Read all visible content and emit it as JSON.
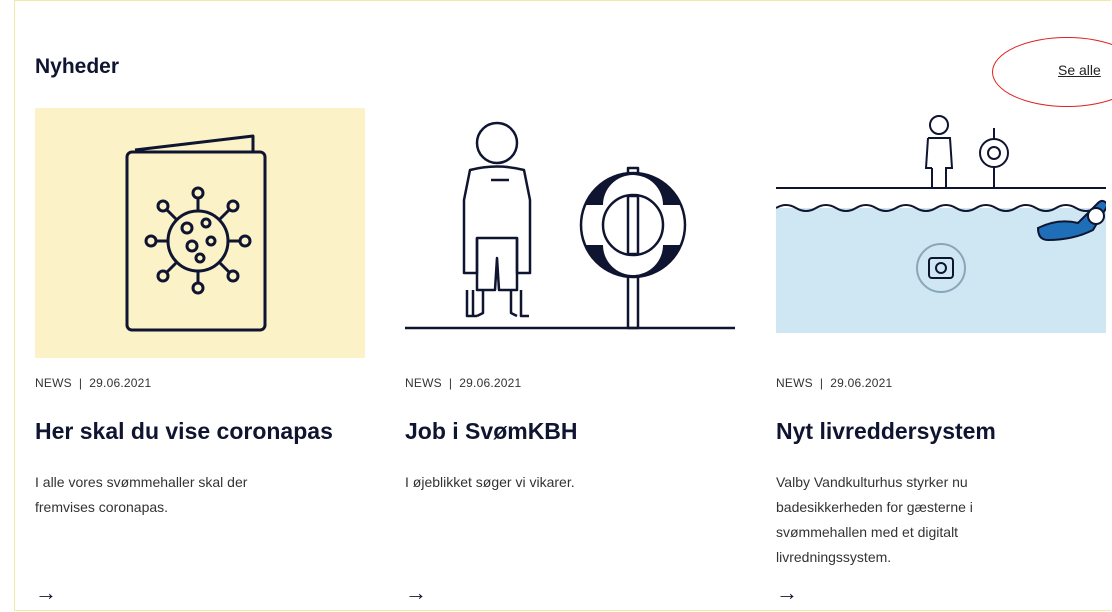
{
  "section": {
    "heading": "Nyheder",
    "see_all": "Se alle"
  },
  "cards": [
    {
      "category": "NEWS",
      "separator": "|",
      "date": "29.06.2021",
      "title": "Her skal du vise coronapas",
      "description": "I alle vores svømmehaller skal der fremvises coronapas.",
      "arrow": "→",
      "image_icon": "corona-passport-icon",
      "bg": "#fbf2c8"
    },
    {
      "category": "NEWS",
      "separator": "|",
      "date": "29.06.2021",
      "title": "Job i SvømKBH",
      "description": "I øjeblikket søger vi vikarer.",
      "arrow": "→",
      "image_icon": "lifeguard-lifebuoy-icon",
      "bg": "#ffffff"
    },
    {
      "category": "NEWS",
      "separator": "|",
      "date": "29.06.2021",
      "title": "Nyt livreddersystem",
      "description": "Valby Vandkulturhus styrker nu badesikkerheden for gæsterne i svømmehallen med et digitalt livredningssystem.",
      "arrow": "→",
      "image_icon": "pool-rescue-system-icon",
      "bg": "#cfe6f3"
    }
  ],
  "colors": {
    "navy": "#0f1530",
    "accent_circle": "#e02020",
    "card1_bg": "#fbf2c8",
    "water": "#cfe6f3"
  }
}
